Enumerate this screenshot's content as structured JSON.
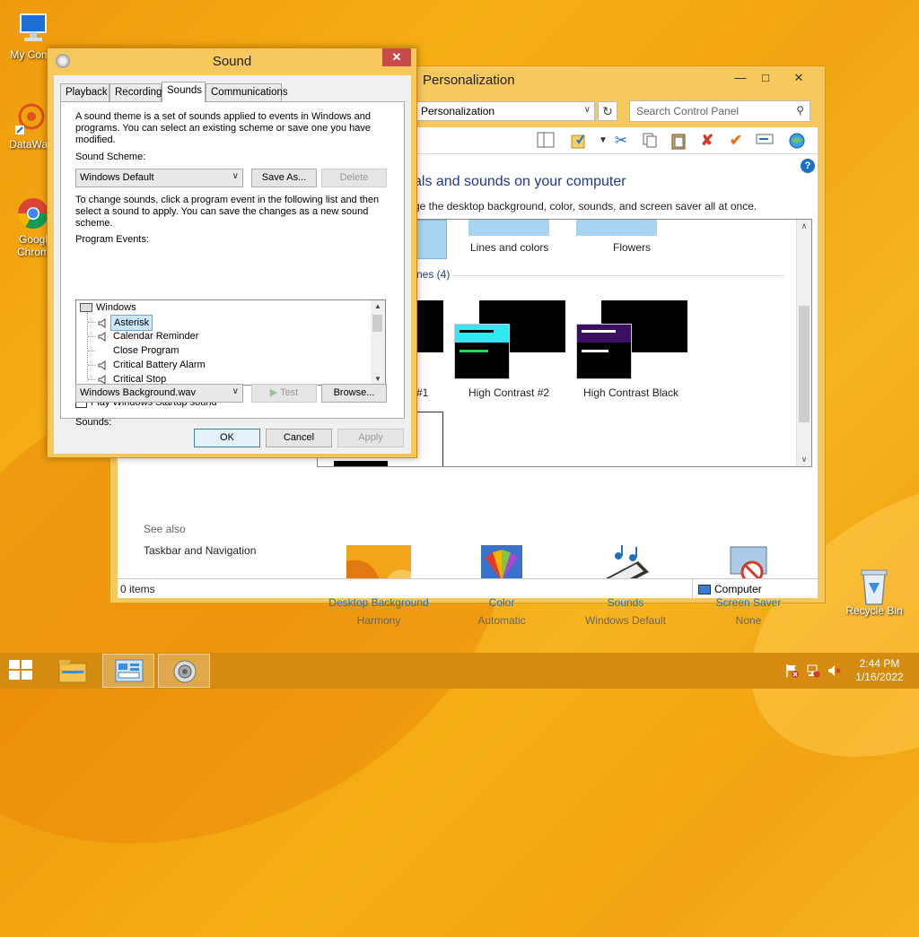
{
  "desktop": {
    "icons": [
      {
        "label": "My Comp",
        "icon": "computer-icon"
      },
      {
        "label": "DataWag",
        "icon": "datawag-icon"
      },
      {
        "label": "Googl Chrom",
        "icon": "chrome-icon"
      },
      {
        "label": "Recycle Bin",
        "icon": "recycle-bin-icon"
      }
    ]
  },
  "personalization": {
    "title": "Personalization",
    "address": "Personalization",
    "search_placeholder": "Search Control Panel",
    "heading": "als and sounds on your computer",
    "subheading": "ge the desktop background, color, sounds, and screen saver all at once.",
    "themes": {
      "top_row": [
        "Lines and colors",
        "Flowers"
      ],
      "group_label": "nes (4)",
      "high_contrast": [
        "#1",
        "High Contrast #2",
        "High Contrast Black"
      ]
    },
    "see_also": {
      "label": "See also",
      "link": "Taskbar and Navigation"
    },
    "bottom_items": [
      {
        "label": "Desktop Background",
        "value": "Harmony",
        "icon": "desktop-background-icon"
      },
      {
        "label": "Color",
        "value": "Automatic",
        "icon": "color-icon"
      },
      {
        "label": "Sounds",
        "value": "Windows Default",
        "icon": "sounds-icon"
      },
      {
        "label": "Screen Saver",
        "value": "None",
        "icon": "screen-saver-icon"
      }
    ],
    "status": {
      "items": "0 items",
      "location": "Computer"
    },
    "colors": {
      "link": "#1f6fc5",
      "heading": "#1e3a8a",
      "title_bar": "#f6c85d"
    }
  },
  "sound_dialog": {
    "title": "Sound",
    "tabs": [
      "Playback",
      "Recording",
      "Sounds",
      "Communications"
    ],
    "active_tab": "Sounds",
    "intro": "A sound theme is a set of sounds applied to events in Windows and programs.  You can select an existing scheme or save one you have modified.",
    "scheme_label": "Sound Scheme:",
    "scheme_value": "Windows Default",
    "save_as": "Save As...",
    "delete": "Delete",
    "instructions": "To change sounds, click a program event in the following list and then select a sound to apply.  You can save the changes as a new sound scheme.",
    "events_label": "Program Events:",
    "events": {
      "group": "Windows",
      "items": [
        "Asterisk",
        "Calendar Reminder",
        "Close Program",
        "Critical Battery Alarm",
        "Critical Stop"
      ],
      "selected": "Asterisk"
    },
    "startup_checkbox": "Play Windows Startup sound",
    "startup_checked": false,
    "sounds_label": "Sounds:",
    "sounds_value": "Windows Background.wav",
    "test": "Test",
    "browse": "Browse...",
    "ok": "OK",
    "cancel": "Cancel",
    "apply": "Apply"
  },
  "taskbar": {
    "apps": [
      "file-explorer-icon",
      "control-panel-icon",
      "sound-icon"
    ],
    "time": "2:44 PM",
    "date": "1/16/2022",
    "color": "#d58b0f"
  }
}
